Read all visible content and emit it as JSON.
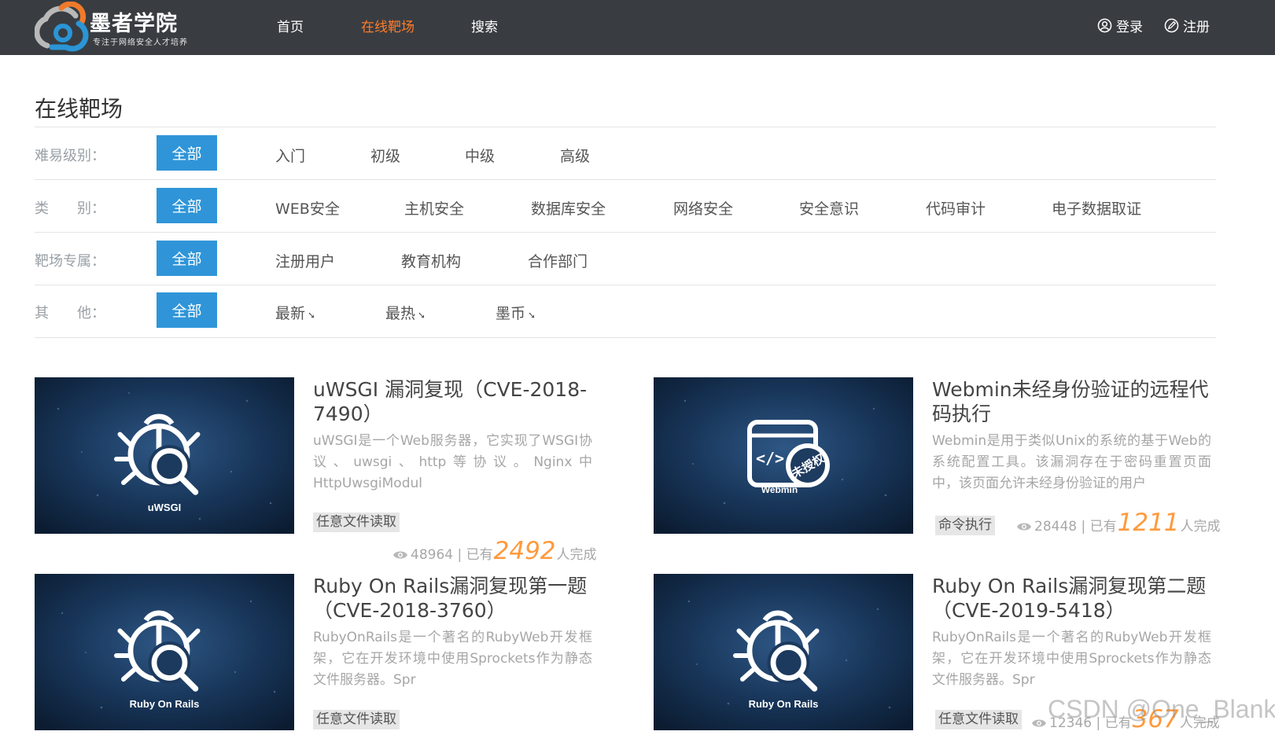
{
  "brand": {
    "name": "墨者学院",
    "slogan": "专注于网络安全人才培养"
  },
  "nav": {
    "items": [
      {
        "label": "首页",
        "active": false
      },
      {
        "label": "在线靶场",
        "active": true
      },
      {
        "label": "搜索",
        "active": false
      }
    ],
    "login": "登录",
    "register": "注册"
  },
  "page": {
    "title": "在线靶场"
  },
  "filters": {
    "difficulty": {
      "label": "难易级别：",
      "all": "全部",
      "options": [
        "入门",
        "初级",
        "中级",
        "高级"
      ]
    },
    "category": {
      "label": "类　　别：",
      "all": "全部",
      "options": [
        "WEB安全",
        "主机安全",
        "数据库安全",
        "网络安全",
        "安全意识",
        "代码审计",
        "电子数据取证"
      ]
    },
    "owner": {
      "label": "靶场专属：",
      "all": "全部",
      "options": [
        "注册用户",
        "教育机构",
        "合作部门"
      ]
    },
    "other": {
      "label": "其　　他：",
      "all": "全部",
      "options": [
        "最新",
        "最热",
        "墨币"
      ]
    }
  },
  "cards": [
    {
      "title": "uWSGI 漏洞复现（CVE-2018-7490）",
      "desc": "uWSGI是一个Web服务器，它实现了WSGI协议、uwsgi、http等协议。Nginx中HttpUwsgiModul",
      "tag": "任意文件读取",
      "views": "48964",
      "completed_prefix": "| 已有",
      "completed": "2492",
      "completed_suffix": "人完成",
      "image_label": "uWSGI",
      "icon": "bug-search-icon"
    },
    {
      "title": "Webmin未经身份验证的远程代码执行",
      "desc": "Webmin是用于类似Unix的系统的基于Web的系统配置工具。该漏洞存在于密码重置页面中，该页面允许未经身份验证的用户",
      "tag": "命令执行",
      "views": "28448",
      "completed_prefix": "| 已有",
      "completed": "1211",
      "completed_suffix": "人完成",
      "image_label": "Webmin",
      "icon": "code-window-icon",
      "stamp_text": "未授权"
    },
    {
      "title": "Ruby On Rails漏洞复现第一题（CVE-2018-3760）",
      "desc": "RubyOnRails是一个著名的RubyWeb开发框架，它在开发环境中使用Sprockets作为静态文件服务器。Spr",
      "tag": "任意文件读取",
      "image_label": "Ruby On Rails",
      "icon": "bug-search-icon"
    },
    {
      "title": "Ruby On Rails漏洞复现第二题（CVE-2019-5418）",
      "desc": "RubyOnRails是一个著名的RubyWeb开发框架，它在开发环境中使用Sprockets作为静态文件服务器。Spr",
      "tag": "任意文件读取",
      "views": "12346",
      "completed_prefix": "| 已有",
      "completed": "367",
      "completed_suffix": "人完成",
      "image_label": "Ruby On Rails",
      "icon": "bug-search-icon"
    }
  ],
  "watermark": "CSDN @One_Blanks",
  "colors": {
    "header_bg": "#393d42",
    "active_nav": "#ff7c2a",
    "filter_active": "#2f95d8",
    "completed_count": "#ff9a3c",
    "card_bg": "#152d4a"
  }
}
